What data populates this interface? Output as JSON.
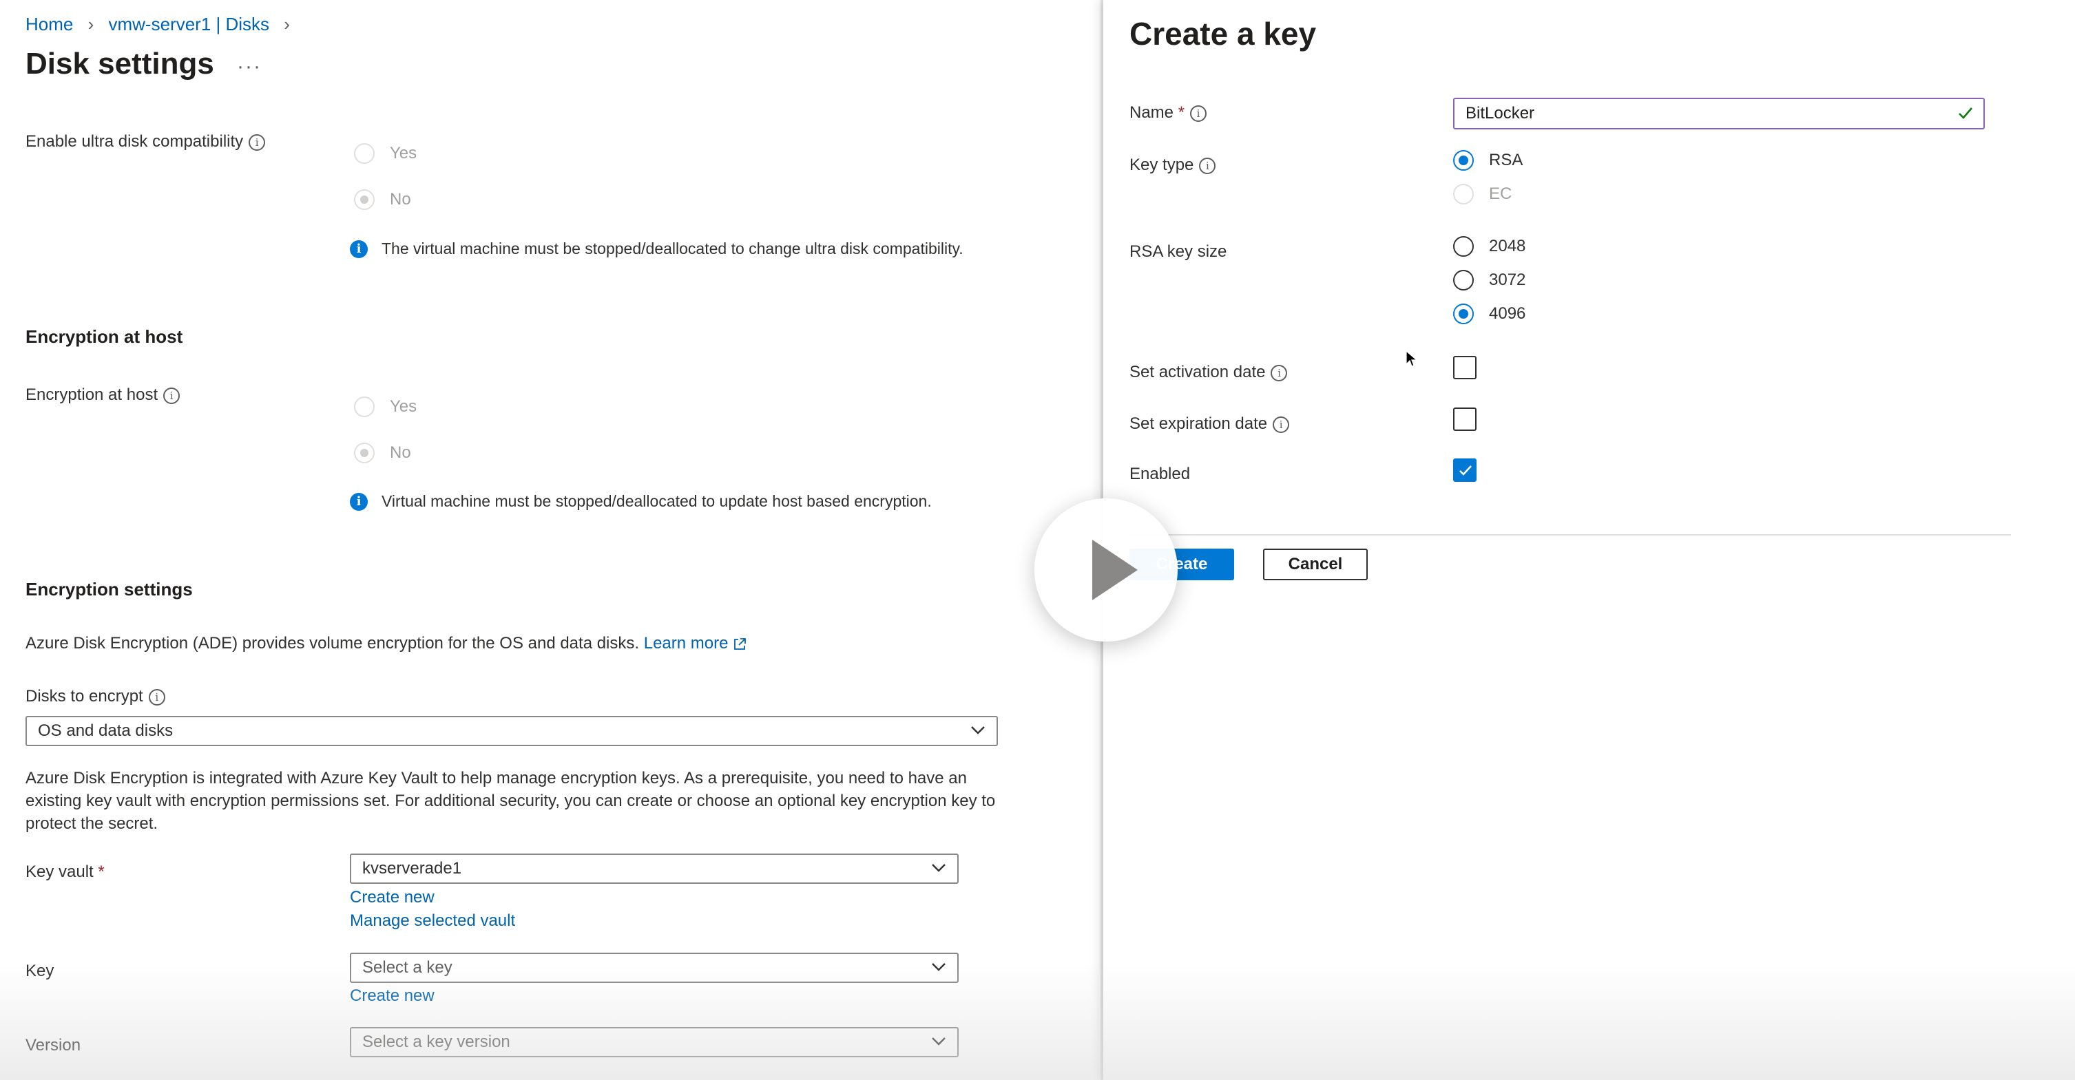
{
  "breadcrumb": {
    "items": [
      "Home",
      "vmw-server1 | Disks"
    ]
  },
  "page": {
    "title": "Disk settings",
    "more": "···"
  },
  "ultra_disk": {
    "label": "Enable ultra disk compatibility",
    "options": [
      "Yes",
      "No"
    ],
    "selected": "No",
    "info": "The virtual machine must be stopped/deallocated to change ultra disk compatibility."
  },
  "encryption_host": {
    "heading": "Encryption at host",
    "label": "Encryption at host",
    "options": [
      "Yes",
      "No"
    ],
    "selected": "No",
    "info": "Virtual machine must be stopped/deallocated to update host based encryption."
  },
  "encryption_settings": {
    "heading": "Encryption settings",
    "description": "Azure Disk Encryption (ADE) provides volume encryption for the OS and data disks.",
    "learn_more": "Learn more",
    "disks_label": "Disks to encrypt",
    "disks_value": "OS and data disks",
    "keyvault_paragraph": "Azure Disk Encryption is integrated with Azure Key Vault to help manage encryption keys. As a prerequisite, you need to have an existing key vault with encryption permissions set. For additional security, you can create or choose an optional key encryption key to protect the secret.",
    "key_vault_label": "Key vault",
    "key_vault_value": "kvserverade1",
    "create_new": "Create new",
    "manage_vault": "Manage selected vault",
    "key_label": "Key",
    "key_placeholder": "Select a key",
    "key_create_new": "Create new",
    "version_label": "Version",
    "version_placeholder": "Select a key version"
  },
  "create_key": {
    "title": "Create a key",
    "name_label": "Name",
    "required_mark": "*",
    "name_value": "BitLocker",
    "key_type_label": "Key type",
    "key_type_options": [
      "RSA",
      "EC"
    ],
    "key_type_selected": "RSA",
    "rsa_size_label": "RSA key size",
    "rsa_size_options": [
      "2048",
      "3072",
      "4096"
    ],
    "rsa_size_selected": "4096",
    "activation_label": "Set activation date",
    "activation_checked": false,
    "expiration_label": "Set expiration date",
    "expiration_checked": false,
    "enabled_label": "Enabled",
    "enabled_checked": true,
    "create_button": "Create",
    "cancel_button": "Cancel"
  },
  "colors": {
    "accent": "#0078d4",
    "link": "#0063b1",
    "input_focus": "#8764b8",
    "valid": "#107c10"
  },
  "icons": [
    "chevron-right-icon",
    "info-icon",
    "external-link-icon",
    "chevron-down-icon",
    "checkmark-icon",
    "play-icon",
    "cursor-icon"
  ]
}
